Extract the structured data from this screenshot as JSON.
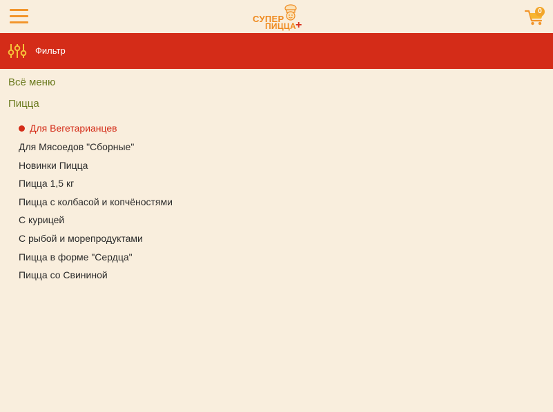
{
  "header": {
    "logo": {
      "line1": "СУПЕР",
      "line2": "ПИЦЦА",
      "plus": "+"
    },
    "cart_count": "0",
    "icons": {
      "menu": "hamburger-menu-icon",
      "cart": "shopping-cart-icon",
      "chef": "chef-mascot-icon"
    },
    "colors": {
      "background": "#f9eedd",
      "accent": "#f2952b"
    }
  },
  "filter": {
    "label": "Фильтр",
    "icon": "sliders-filter-icon",
    "background": "#d42c18"
  },
  "nav": {
    "all_menu": "Всё меню",
    "category": "Пицца",
    "subcategories": [
      {
        "label": "Для Вегетарианцев",
        "active": true
      },
      {
        "label": "Для Мясоедов \"Сборные\"",
        "active": false
      },
      {
        "label": "Новинки Пицца",
        "active": false
      },
      {
        "label": "Пицца 1,5 кг",
        "active": false
      },
      {
        "label": "Пицца с колбасой и копчёностями",
        "active": false
      },
      {
        "label": "С курицей",
        "active": false
      },
      {
        "label": "С рыбой и морепродуктами",
        "active": false
      },
      {
        "label": "Пицца в форме \"Сердца\"",
        "active": false
      },
      {
        "label": "Пицца со Свининой",
        "active": false
      }
    ],
    "colors": {
      "top_level": "#6b7a1e",
      "item": "#2b2b2b",
      "active": "#d42c18"
    }
  }
}
